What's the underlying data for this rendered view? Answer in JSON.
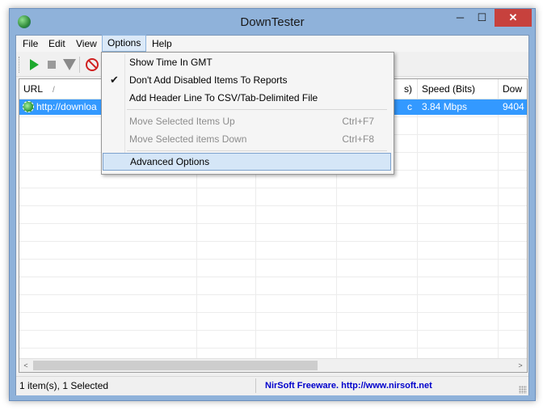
{
  "window": {
    "title": "DownTester",
    "minimize_glyph": "─",
    "maximize_glyph": "☐",
    "close_glyph": "✕"
  },
  "menubar": {
    "items": [
      {
        "label": "File"
      },
      {
        "label": "Edit"
      },
      {
        "label": "View"
      },
      {
        "label": "Options"
      },
      {
        "label": "Help"
      }
    ]
  },
  "toolbar": {
    "buttons": [
      "play-icon",
      "stop-icon",
      "down-triangle-icon",
      "no-entry-icon"
    ]
  },
  "list": {
    "columns": [
      {
        "label": "URL",
        "sort_glyph": "/"
      },
      {
        "label": ""
      },
      {
        "label": ""
      },
      {
        "label": "s)"
      },
      {
        "label": "Speed (Bits)"
      },
      {
        "label": "Dow"
      }
    ],
    "rows": [
      {
        "url": "http://downloa",
        "c4": "c",
        "speed": "3.84 Mbps",
        "down": "9404"
      }
    ]
  },
  "options_menu": {
    "items": [
      {
        "label": "Show Time In GMT",
        "checked": false,
        "disabled": false,
        "shortcut": ""
      },
      {
        "label": "Don't Add Disabled Items To Reports",
        "checked": true,
        "check_glyph": "✔",
        "disabled": false,
        "shortcut": ""
      },
      {
        "label": "Add Header Line To CSV/Tab-Delimited File",
        "checked": false,
        "disabled": false,
        "shortcut": ""
      },
      {
        "label": "Move Selected Items Up",
        "checked": false,
        "disabled": true,
        "shortcut": "Ctrl+F7"
      },
      {
        "label": "Move Selected items Down",
        "checked": false,
        "disabled": true,
        "shortcut": "Ctrl+F8"
      },
      {
        "label": "Advanced Options",
        "checked": false,
        "disabled": false,
        "shortcut": "",
        "highlighted": true
      }
    ]
  },
  "scrollbar": {
    "left_glyph": "<",
    "right_glyph": ">"
  },
  "statusbar": {
    "items_text": "1 item(s), 1 Selected",
    "credit_text": "NirSoft Freeware.  http://www.nirsoft.net"
  },
  "colors": {
    "selection": "#3399ff",
    "frame": "#8fb2da",
    "close_button": "#c7413d",
    "credit_link": "#0000cc"
  }
}
